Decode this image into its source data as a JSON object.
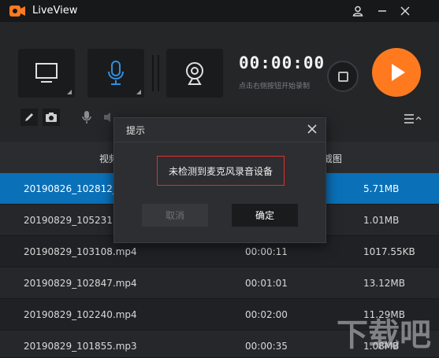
{
  "app": {
    "title": "LiveView"
  },
  "titlebar": {
    "user_icon": "user-icon",
    "minimize_icon": "minimize-icon",
    "close_icon": "close-icon"
  },
  "recorder": {
    "timer": "00:00:00",
    "hint": "点击右侧按钮开始录制",
    "sources": [
      "screen-icon",
      "microphone-icon",
      "webcam-icon"
    ]
  },
  "table": {
    "headers": [
      "视频",
      "",
      "截图"
    ],
    "rows": [
      {
        "name": "20190826_102812_c",
        "duration": "",
        "size": "5.71MB",
        "selected": true
      },
      {
        "name": "20190829_105231.m",
        "duration": "",
        "size": "1.01MB",
        "selected": false
      },
      {
        "name": "20190829_103108.mp4",
        "duration": "00:00:11",
        "size": "1017.55KB",
        "selected": false
      },
      {
        "name": "20190829_102847.mp4",
        "duration": "00:01:01",
        "size": "13.12MB",
        "selected": false
      },
      {
        "name": "20190829_102240.mp4",
        "duration": "00:02:00",
        "size": "11.29MB",
        "selected": false
      },
      {
        "name": "20190829_101855.mp3",
        "duration": "00:00:35",
        "size": "1.08MB",
        "selected": false
      }
    ]
  },
  "dialog": {
    "title": "提示",
    "message": "未检测到麦克风录音设备",
    "cancel_label": "取消",
    "ok_label": "确定"
  },
  "colors": {
    "accent": "#ff7a1f",
    "selection": "#0a70b8",
    "mic_active": "#2f8fe0",
    "alert_border": "#e23030"
  },
  "watermark": {
    "text": "下载吧"
  }
}
